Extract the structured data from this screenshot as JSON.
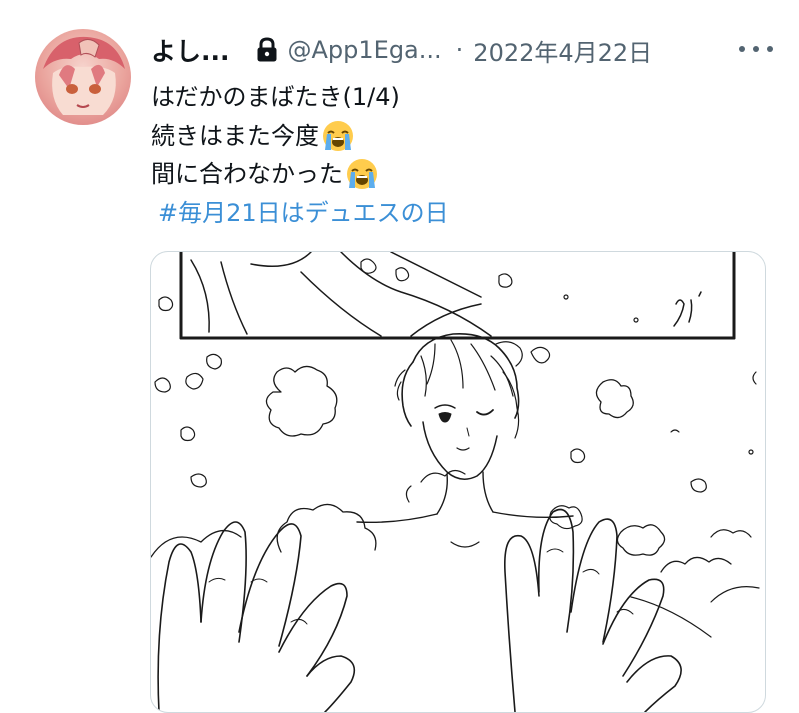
{
  "tweet": {
    "display_name": "よし...",
    "handle": "@App1Ega...",
    "separator": "·",
    "date": "2022年4月22日",
    "lines": [
      "はだかのまばたき(1/4)",
      "続きはまた今度",
      "間に合わなかった"
    ],
    "emoji": "loudly-crying-face",
    "hashtag": "#毎月21日はデュエスの日",
    "media_signature": "Yi"
  },
  "icons": {
    "lock": "lock-icon",
    "more": "more-icon"
  },
  "colors": {
    "hashtag": "#3b8fd6",
    "secondary_text": "#536471",
    "primary_text": "#0f1419",
    "media_border": "#cfd9de"
  }
}
